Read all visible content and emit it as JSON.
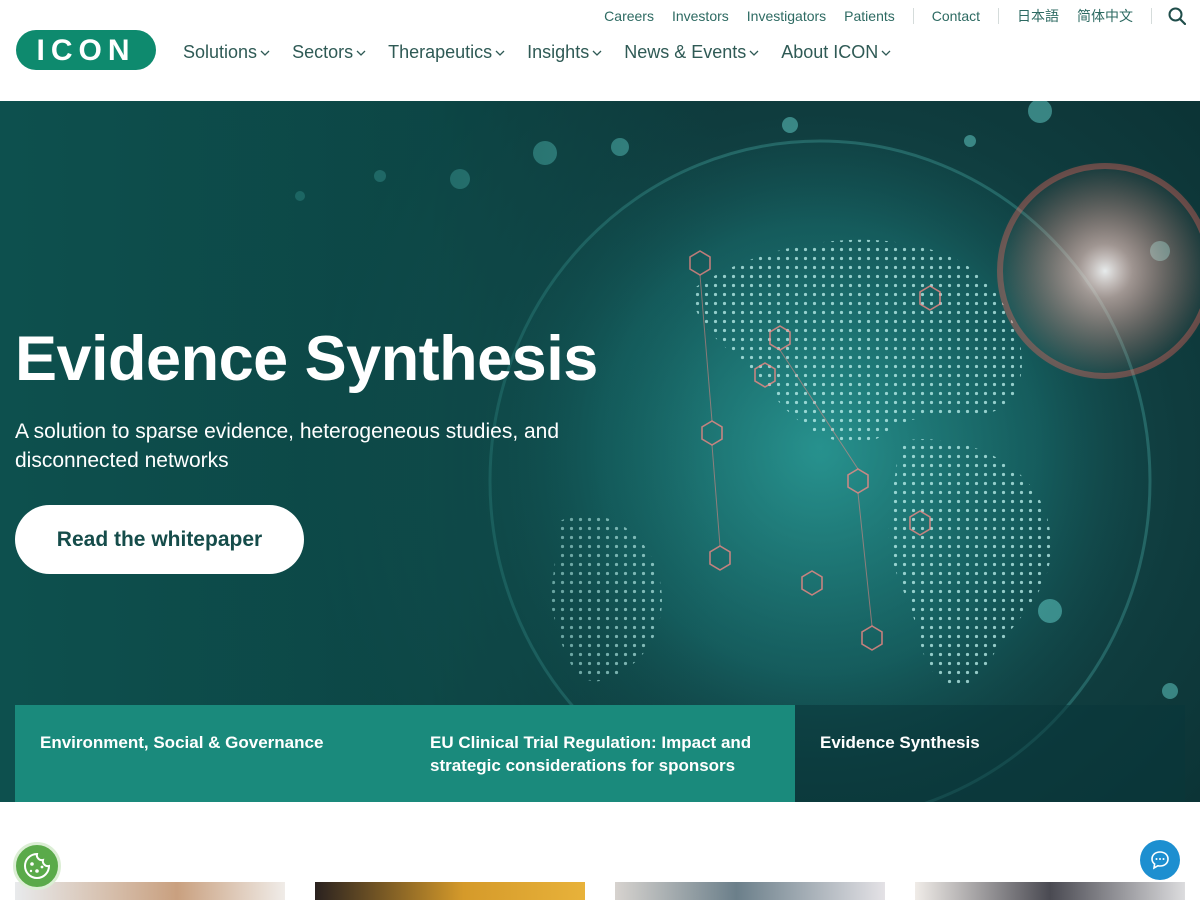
{
  "brand": {
    "logo_text": "ICON",
    "color": "#0e8a6e"
  },
  "utility_nav": {
    "links": [
      "Careers",
      "Investors",
      "Investigators",
      "Patients"
    ],
    "contact": "Contact",
    "languages": [
      "日本語",
      "简体中文"
    ],
    "search_icon": "search-icon"
  },
  "main_nav": {
    "items": [
      "Solutions",
      "Sectors",
      "Therapeutics",
      "Insights",
      "News & Events",
      "About ICON"
    ]
  },
  "hero": {
    "title": "Evidence Synthesis",
    "subtitle": "A solution to sparse evidence, heterogeneous studies, and disconnected networks",
    "cta_label": "Read the whitepaper"
  },
  "carousel_tabs": [
    {
      "label": "Environment, Social & Governance"
    },
    {
      "label": "EU Clinical Trial Regulation: Impact and strategic considerations for sponsors"
    },
    {
      "label": "Evidence Synthesis"
    }
  ],
  "colors": {
    "accent_teal": "#1a8a7c",
    "hero_dark": "#0f4a4c",
    "chat_blue": "#1d8fd0",
    "cookie_green": "#5aaa4a"
  },
  "widgets": {
    "cookie_icon": "cookie-icon",
    "chat_icon": "chat-bubble-icon"
  }
}
